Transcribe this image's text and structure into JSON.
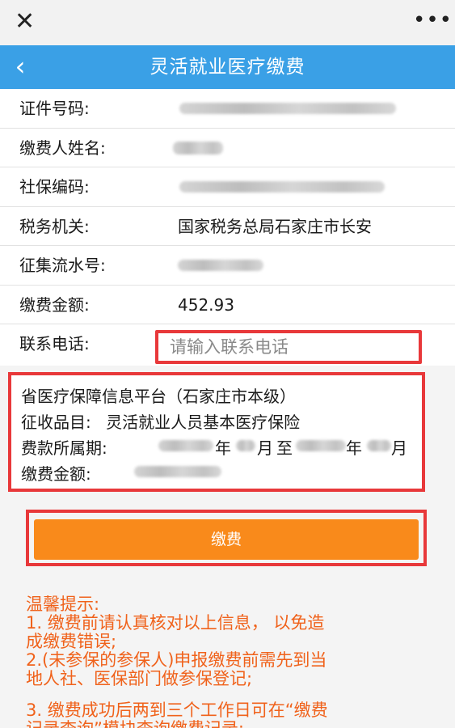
{
  "topbar": {
    "close_icon": "close-icon",
    "more_icon": "more-icon",
    "close_glyph": "✕",
    "more_glyph": "•••"
  },
  "header": {
    "back_glyph": "‹",
    "title": "灵活就业医疗缴费"
  },
  "form": {
    "rows": [
      {
        "label": "证件号码:",
        "value": ""
      },
      {
        "label": "缴费人姓名:",
        "value": ""
      },
      {
        "label": "社保编码:",
        "value": ""
      },
      {
        "label": "税务机关:",
        "value": "国家税务总局石家庄市长安"
      },
      {
        "label": "征集流水号:",
        "value": ""
      },
      {
        "label": "缴费金额:",
        "value": "452.93"
      },
      {
        "label": "联系电话:",
        "value": ""
      }
    ],
    "phone_placeholder": "请输入联系电话"
  },
  "item": {
    "platform": "省医疗保障信息平台（石家庄市本级）",
    "category_label": "征收品目:",
    "category_value": "灵活就业人员基本医疗保险",
    "period_label": "费款所属期:",
    "period_year": "年",
    "period_month": "月",
    "period_to": "至",
    "amount_label": "缴费金额:"
  },
  "pay_button": "缴费",
  "tips": {
    "lines": [
      "温馨提示:",
      "1. 缴费前请认真核对以上信息， 以免造",
      "成缴费错误;",
      "2.(未参保的参保人)申报缴费前需先到当",
      "地人社、医保部门做参保登记;",
      "",
      "3. 缴费成功后两到三个工作日可在“缴费",
      "记录查询”模块查询缴费记录;"
    ]
  },
  "colors": {
    "header_blue": "#3aa0e6",
    "highlight_red": "#e8383a",
    "button_orange": "#f98a1b",
    "tip_orange": "#f0621b"
  }
}
